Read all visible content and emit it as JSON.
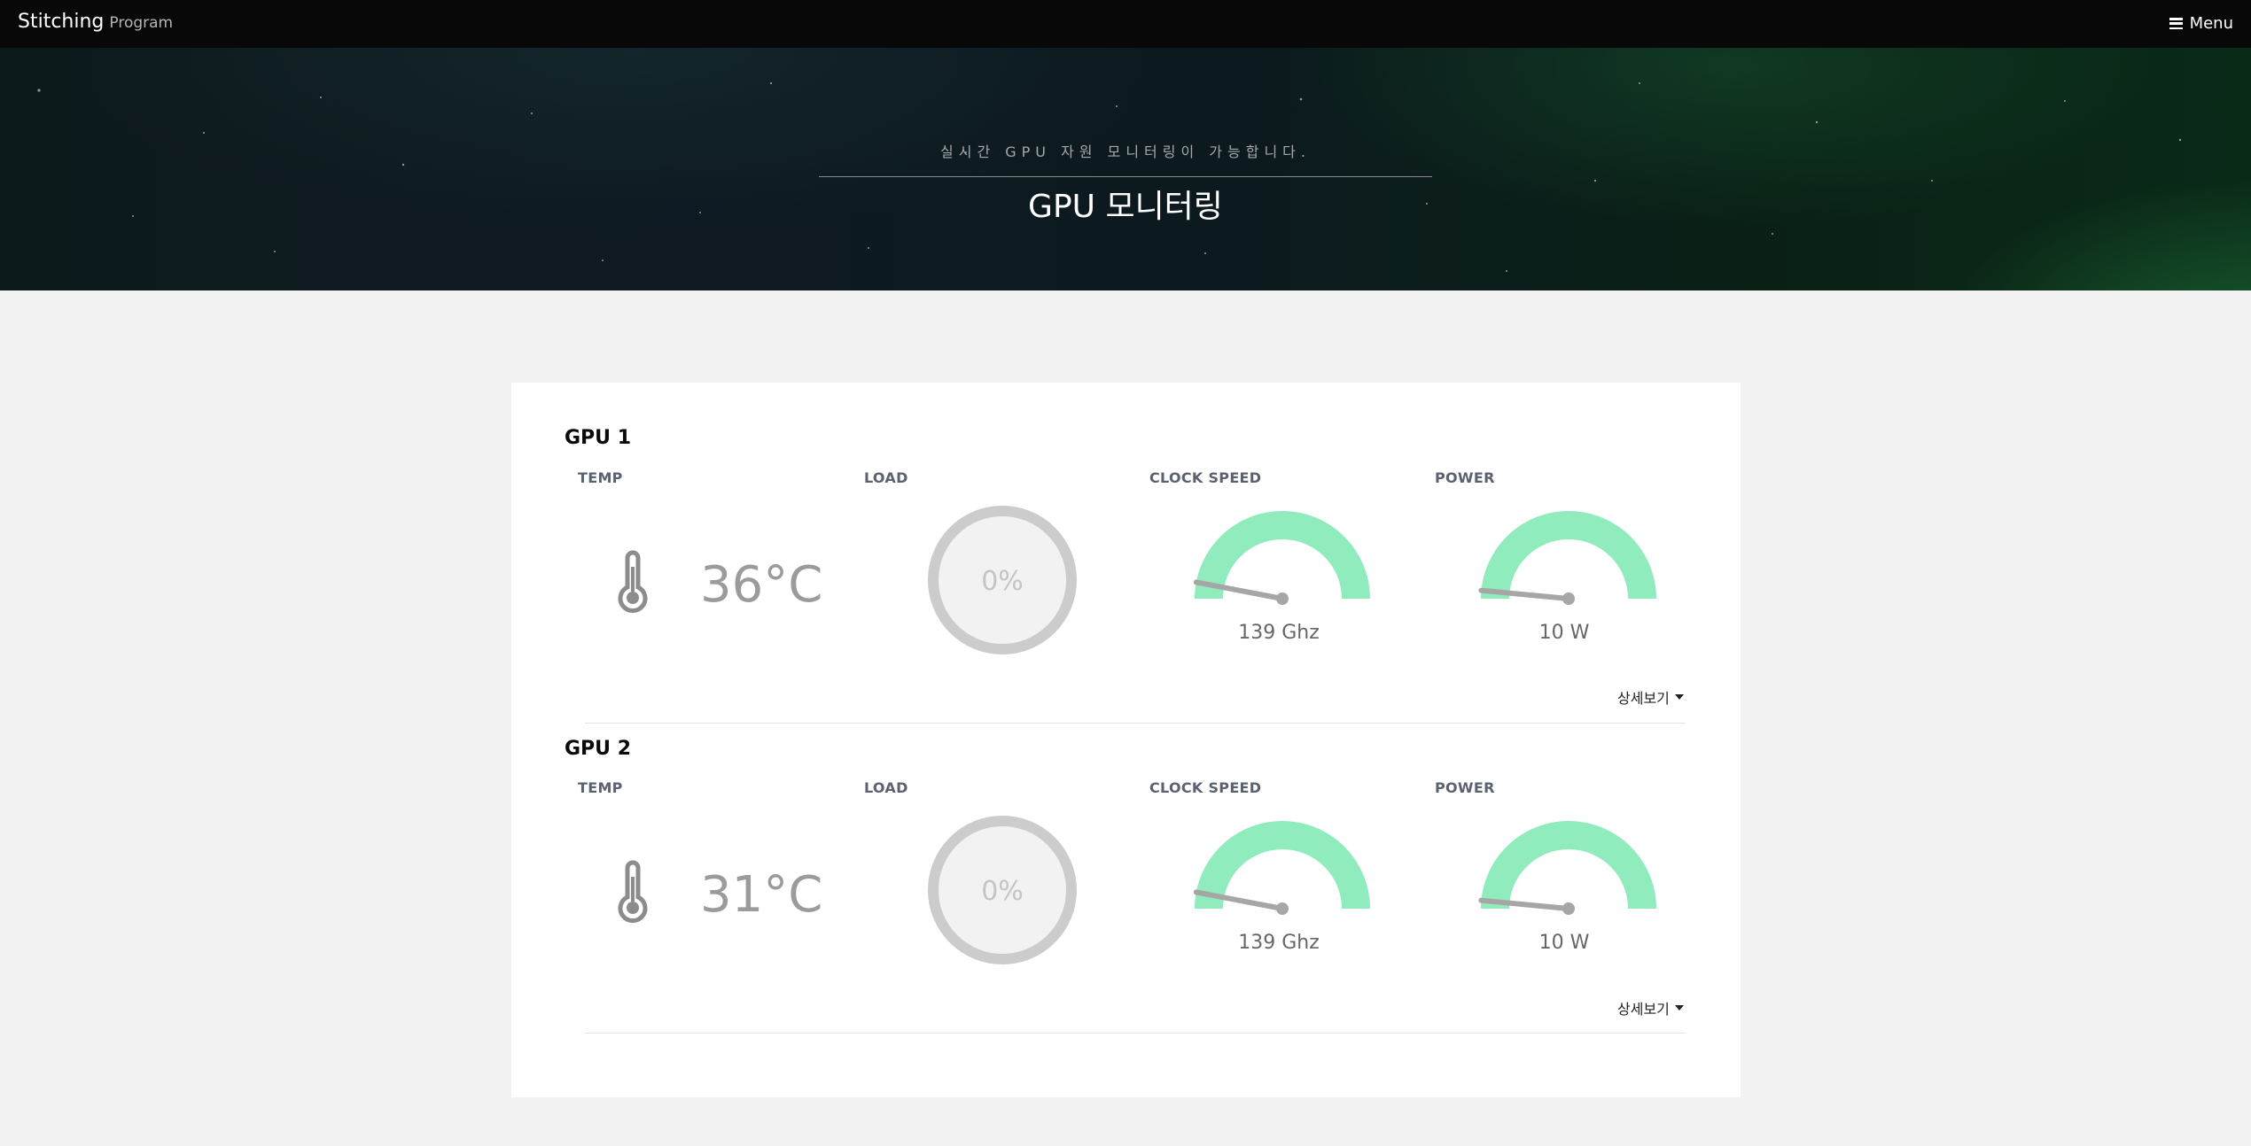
{
  "navbar": {
    "brand": "Stitching",
    "brand_sub": "Program",
    "menu_label": "Menu"
  },
  "hero": {
    "subtitle": "실시간 GPU 자원 모니터링이 가능합니다.",
    "title": "GPU 모니터링"
  },
  "labels": {
    "temp": "TEMP",
    "load": "LOAD",
    "clock": "CLOCK SPEED",
    "power": "POWER",
    "detail": "상세보기"
  },
  "colors": {
    "gauge_fill": "#90ebbd",
    "needle": "#a6a6a6",
    "dial_ring": "#cccccc",
    "dial_fill": "#f2f2f2"
  },
  "gpus": [
    {
      "name": "GPU 1",
      "temp": "36°C",
      "load": "0%",
      "load_level": 0,
      "clock": "139 Ghz",
      "clock_level": 0.06,
      "power": "10 W",
      "power_level": 0.03
    },
    {
      "name": "GPU 2",
      "temp": "31°C",
      "load": "0%",
      "load_level": 0,
      "clock": "139 Ghz",
      "clock_level": 0.06,
      "power": "10 W",
      "power_level": 0.03
    }
  ]
}
